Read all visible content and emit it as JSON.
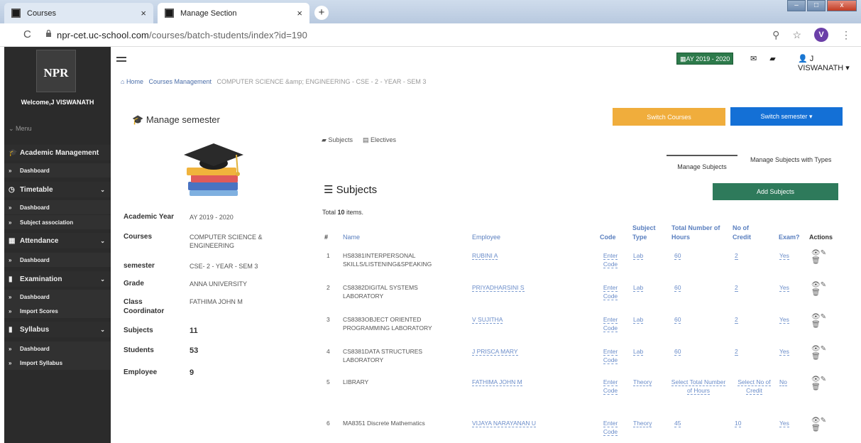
{
  "browser": {
    "tabs": [
      {
        "title": "Courses"
      },
      {
        "title": "Manage Section"
      }
    ],
    "url_host": "npr-cet.uc-school.com",
    "url_path": "/courses/batch-students/index?id=190",
    "profile_initial": "V"
  },
  "sidebar": {
    "logo": "NPR",
    "welcome": "Welcome,J VISWANATH",
    "menu_label": "Menu",
    "items": [
      {
        "label": "Academic Management",
        "icon": "graduation-cap-icon"
      },
      {
        "label": "Dashboard"
      },
      {
        "label": "Timetable",
        "icon": "clock-icon"
      },
      {
        "label": "Dashboard"
      },
      {
        "label": "Subject association"
      },
      {
        "label": "Attendance",
        "icon": "calendar-icon"
      },
      {
        "label": "Dashboard"
      },
      {
        "label": "Examination",
        "icon": "file-icon"
      },
      {
        "label": "Dashboard"
      },
      {
        "label": "Import Scores"
      },
      {
        "label": "Syllabus",
        "icon": "file-icon"
      },
      {
        "label": "Dashboard"
      },
      {
        "label": "Import Syllabus"
      }
    ]
  },
  "topbar": {
    "academic_year_badge": "AY 2019 - 2020",
    "user_name": "J VISWANATH"
  },
  "breadcrumb": {
    "home": "Home",
    "courses": "Courses Management",
    "current": "COMPUTER SCIENCE &amp; ENGINEERING - CSE - 2 - YEAR - SEM 3"
  },
  "manage": {
    "title": "Manage semester",
    "switch_courses": "Switch Courses",
    "switch_semester": "Switch semester",
    "info": [
      {
        "label": "Academic Year",
        "value": "AY 2019 - 2020"
      },
      {
        "label": "Courses",
        "value": "COMPUTER SCIENCE & ENGINEERING"
      },
      {
        "label": "semester",
        "value": "CSE- 2 - YEAR - SEM 3"
      },
      {
        "label": "Grade",
        "value": "ANNA UNIVERSITY"
      },
      {
        "label": "Class Coordinator",
        "value": "FATHIMA JOHN M"
      },
      {
        "label": "Subjects",
        "value": "11"
      },
      {
        "label": "Students",
        "value": "53"
      },
      {
        "label": "Employee",
        "value": "9"
      }
    ]
  },
  "subnav": {
    "subjects": "Subjects",
    "electives": "Electives"
  },
  "tabs": {
    "manage_subjects": "Manage Subjects",
    "manage_types": "Manage Subjects with Types"
  },
  "subjects": {
    "heading": "Subjects",
    "add_button": "Add Subjects",
    "total_prefix": "Total ",
    "total_count": "10",
    "total_suffix": " items.",
    "columns": {
      "num": "#",
      "name": "Name",
      "employee": "Employee",
      "code": "Code",
      "type": "Subject Type",
      "hours": "Total Number of Hours",
      "credit": "No of Credit",
      "exam": "Exam?",
      "actions": "Actions"
    },
    "rows": [
      {
        "num": "1",
        "name": "HS8381INTERPERSONAL SKILLS/LISTENING&SPEAKING",
        "employee": "RUBINI A",
        "code": "Enter Code",
        "type": "Lab",
        "hours": "60",
        "credit": "2",
        "exam": "Yes"
      },
      {
        "num": "2",
        "name": "CS8382DIGITAL SYSTEMS LABORATORY",
        "employee": "PRIYADHARSINI S",
        "code": "Enter Code",
        "type": "Lab",
        "hours": "60",
        "credit": "2",
        "exam": "Yes"
      },
      {
        "num": "3",
        "name": "CS8383OBJECT ORIENTED PROGRAMMING LABORATORY",
        "employee": "V SUJITHA",
        "code": "Enter Code",
        "type": "Lab",
        "hours": "60",
        "credit": "2",
        "exam": "Yes"
      },
      {
        "num": "4",
        "name": "CS8381DATA STRUCTURES LABORATORY",
        "employee": "J PRISCA MARY",
        "code": "Enter Code",
        "type": "Lab",
        "hours": "60",
        "credit": "2",
        "exam": "Yes"
      },
      {
        "num": "5",
        "name": "LIBRARY",
        "employee": "FATHIMA JOHN M",
        "code": "Enter Code",
        "type": "Theory",
        "hours": "Select Total Number of Hours",
        "credit": "Select No of Credit",
        "exam": "No"
      },
      {
        "num": "6",
        "name": "MA8351 Discrete Mathematics",
        "employee": "VIJAYA NARAYANAN U",
        "code": "Enter Code",
        "type": "Theory",
        "hours": "45",
        "credit": "10",
        "exam": "Yes"
      }
    ]
  }
}
